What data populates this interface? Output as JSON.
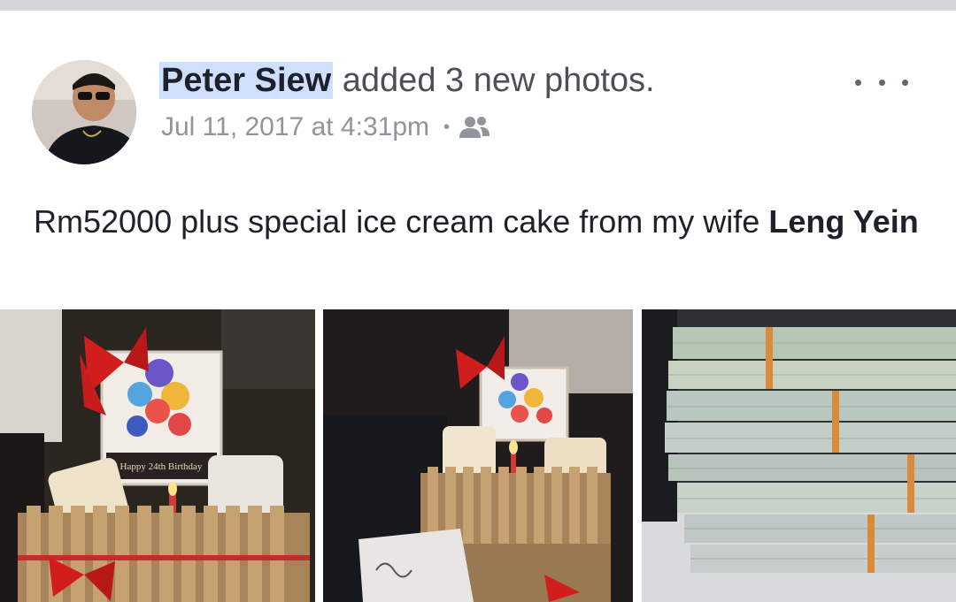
{
  "post": {
    "author": "Peter Siew",
    "action": "added 3 new photos.",
    "timestamp": "Jul 11, 2017 at 4:31pm",
    "separator": "•",
    "audience_icon": "friends-icon",
    "more_icon": "more-options-icon",
    "text_prefix": "Rm52000 plus special ice cream cake from my wife",
    "tagged_name": "Leng Yein"
  },
  "photos": [
    {
      "name": "photo-gift-box-front",
      "card_text": "Happy 24th Birthday"
    },
    {
      "name": "photo-gift-box-side",
      "card_text": ""
    },
    {
      "name": "photo-cash-stack",
      "card_text": ""
    }
  ],
  "colors": {
    "author_highlight": "#cfe0ff",
    "meta_gray": "#90949c",
    "text": "#1d2129"
  }
}
